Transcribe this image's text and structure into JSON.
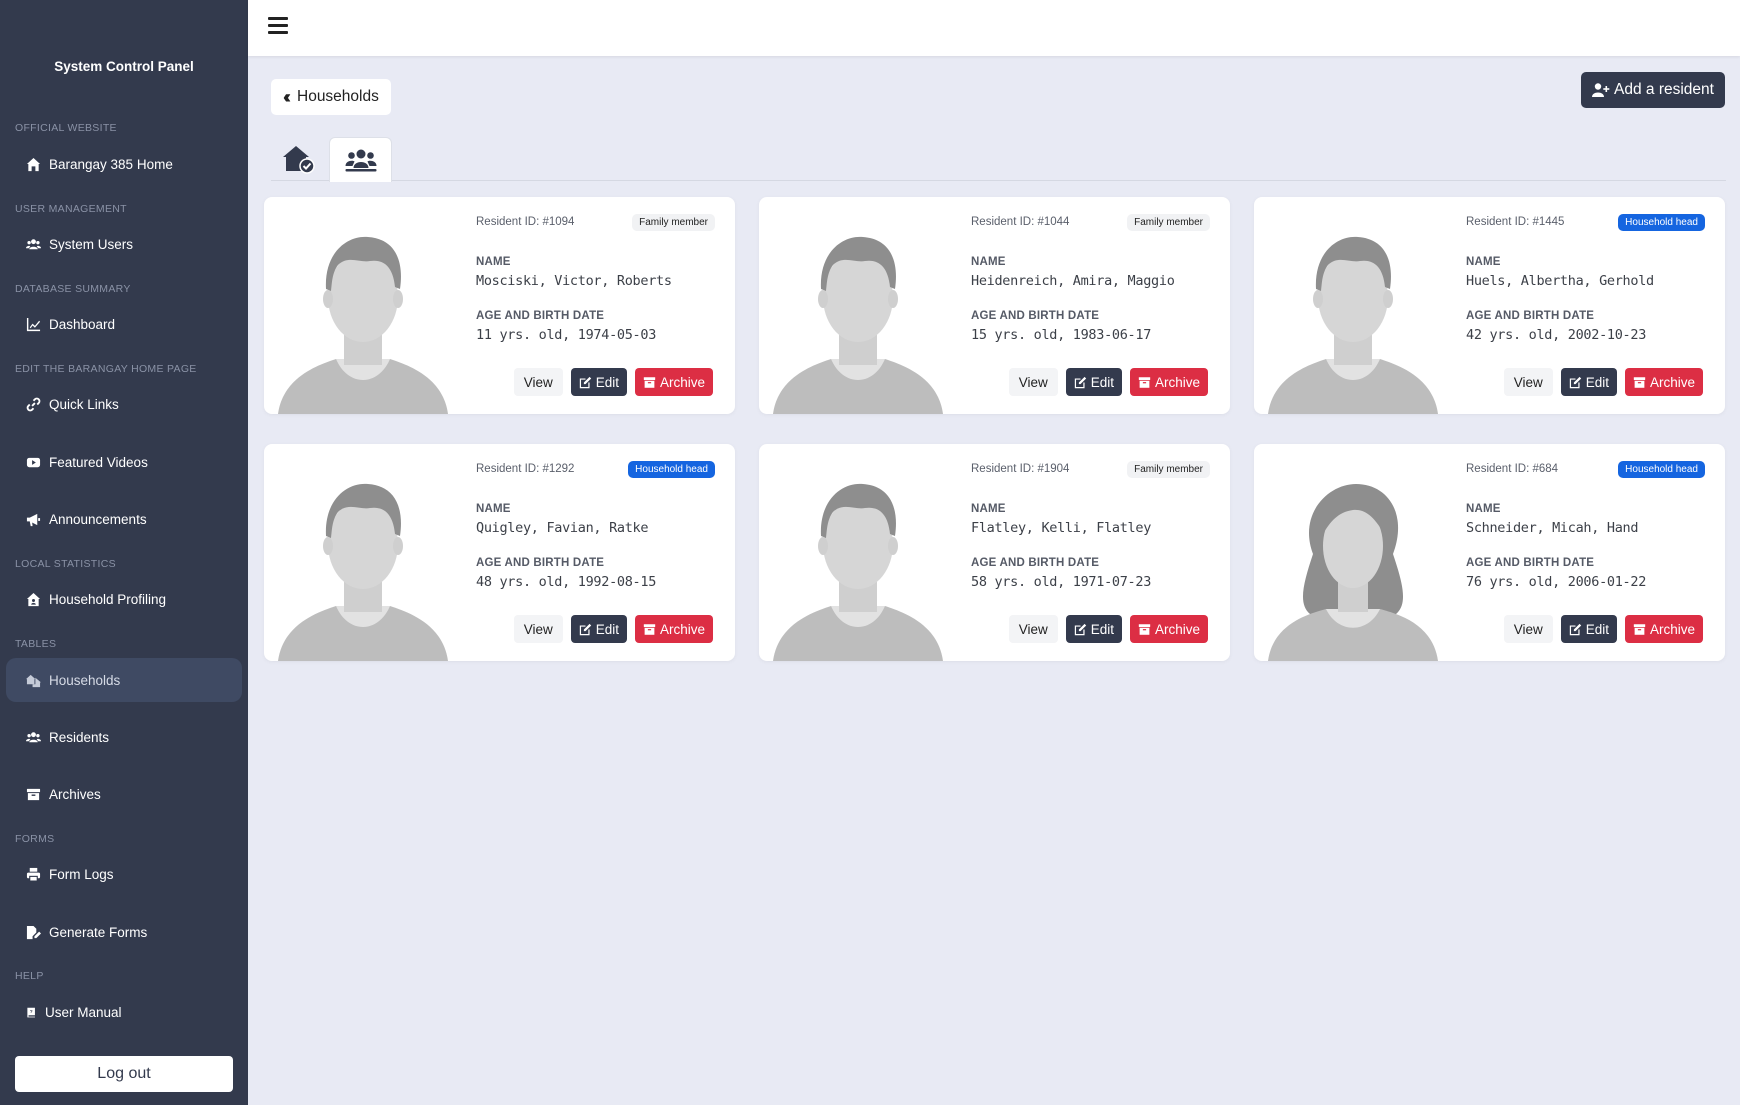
{
  "sidebar": {
    "brand": "System Control Panel",
    "sections": [
      {
        "title": "OFFICIAL WEBSITE",
        "items": [
          {
            "label": "Barangay 385 Home",
            "icon": "home-icon"
          }
        ]
      },
      {
        "title": "USER MANAGEMENT",
        "items": [
          {
            "label": "System Users",
            "icon": "users-icon"
          }
        ]
      },
      {
        "title": "DATABASE SUMMARY",
        "items": [
          {
            "label": "Dashboard",
            "icon": "chart-line-icon"
          }
        ]
      },
      {
        "title": "EDIT THE BARANGAY HOME PAGE",
        "items": [
          {
            "label": "Quick Links",
            "icon": "link-icon"
          },
          {
            "label": "Featured Videos",
            "icon": "youtube-icon"
          },
          {
            "label": "Announcements",
            "icon": "bullhorn-icon"
          }
        ]
      },
      {
        "title": "LOCAL STATISTICS",
        "items": [
          {
            "label": "Household Profiling",
            "icon": "house-user-icon"
          }
        ]
      },
      {
        "title": "TABLES",
        "items": [
          {
            "label": "Households",
            "icon": "houses-icon",
            "active": true
          },
          {
            "label": "Residents",
            "icon": "people-icon"
          },
          {
            "label": "Archives",
            "icon": "archive-icon"
          }
        ]
      },
      {
        "title": "FORMS",
        "items": [
          {
            "label": "Form Logs",
            "icon": "print-icon"
          },
          {
            "label": "Generate Forms",
            "icon": "file-pen-icon"
          }
        ]
      },
      {
        "title": "HELP",
        "items": [
          {
            "label": "User Manual",
            "icon": "book-icon"
          }
        ]
      }
    ],
    "logout_label": "Log out"
  },
  "toolbar": {
    "back_label": "Households",
    "add_label": "Add a resident"
  },
  "tabs": [
    {
      "icon": "house-check-icon"
    },
    {
      "icon": "people-group-icon",
      "active": true
    }
  ],
  "residents": [
    {
      "id": "Resident ID: #1094",
      "role": "Family member",
      "role_type": "fam",
      "name_label": "NAME",
      "name": "Mosciski, Victor, Roberts",
      "age_label": "AGE AND BIRTH DATE",
      "age": "11 yrs. old, 1974-05-03",
      "avatar": "male"
    },
    {
      "id": "Resident ID: #1044",
      "role": "Family member",
      "role_type": "fam",
      "name_label": "NAME",
      "name": "Heidenreich, Amira, Maggio",
      "age_label": "AGE AND BIRTH DATE",
      "age": "15 yrs. old, 1983-06-17",
      "avatar": "male"
    },
    {
      "id": "Resident ID: #1445",
      "role": "Household head",
      "role_type": "head",
      "name_label": "NAME",
      "name": "Huels, Albertha, Gerhold",
      "age_label": "AGE AND BIRTH DATE",
      "age": "42 yrs. old, 2002-10-23",
      "avatar": "male"
    },
    {
      "id": "Resident ID: #1292",
      "role": "Household head",
      "role_type": "head",
      "name_label": "NAME",
      "name": "Quigley, Favian, Ratke",
      "age_label": "AGE AND BIRTH DATE",
      "age": "48 yrs. old, 1992-08-15",
      "avatar": "male"
    },
    {
      "id": "Resident ID: #1904",
      "role": "Family member",
      "role_type": "fam",
      "name_label": "NAME",
      "name": "Flatley, Kelli, Flatley",
      "age_label": "AGE AND BIRTH DATE",
      "age": "58 yrs. old, 1971-07-23",
      "avatar": "male"
    },
    {
      "id": "Resident ID: #684",
      "role": "Household head",
      "role_type": "head",
      "name_label": "NAME",
      "name": "Schneider, Micah, Hand",
      "age_label": "AGE AND BIRTH DATE",
      "age": "76 yrs. old, 2006-01-22",
      "avatar": "female"
    }
  ],
  "card_buttons": {
    "view": "View",
    "edit": "Edit",
    "archive": "Archive"
  },
  "colors": {
    "sidebar": "#333a4d",
    "background": "#e8eaf4",
    "primary": "#333a4d",
    "danger": "#dc2e44",
    "badge_head": "#1565e0"
  }
}
